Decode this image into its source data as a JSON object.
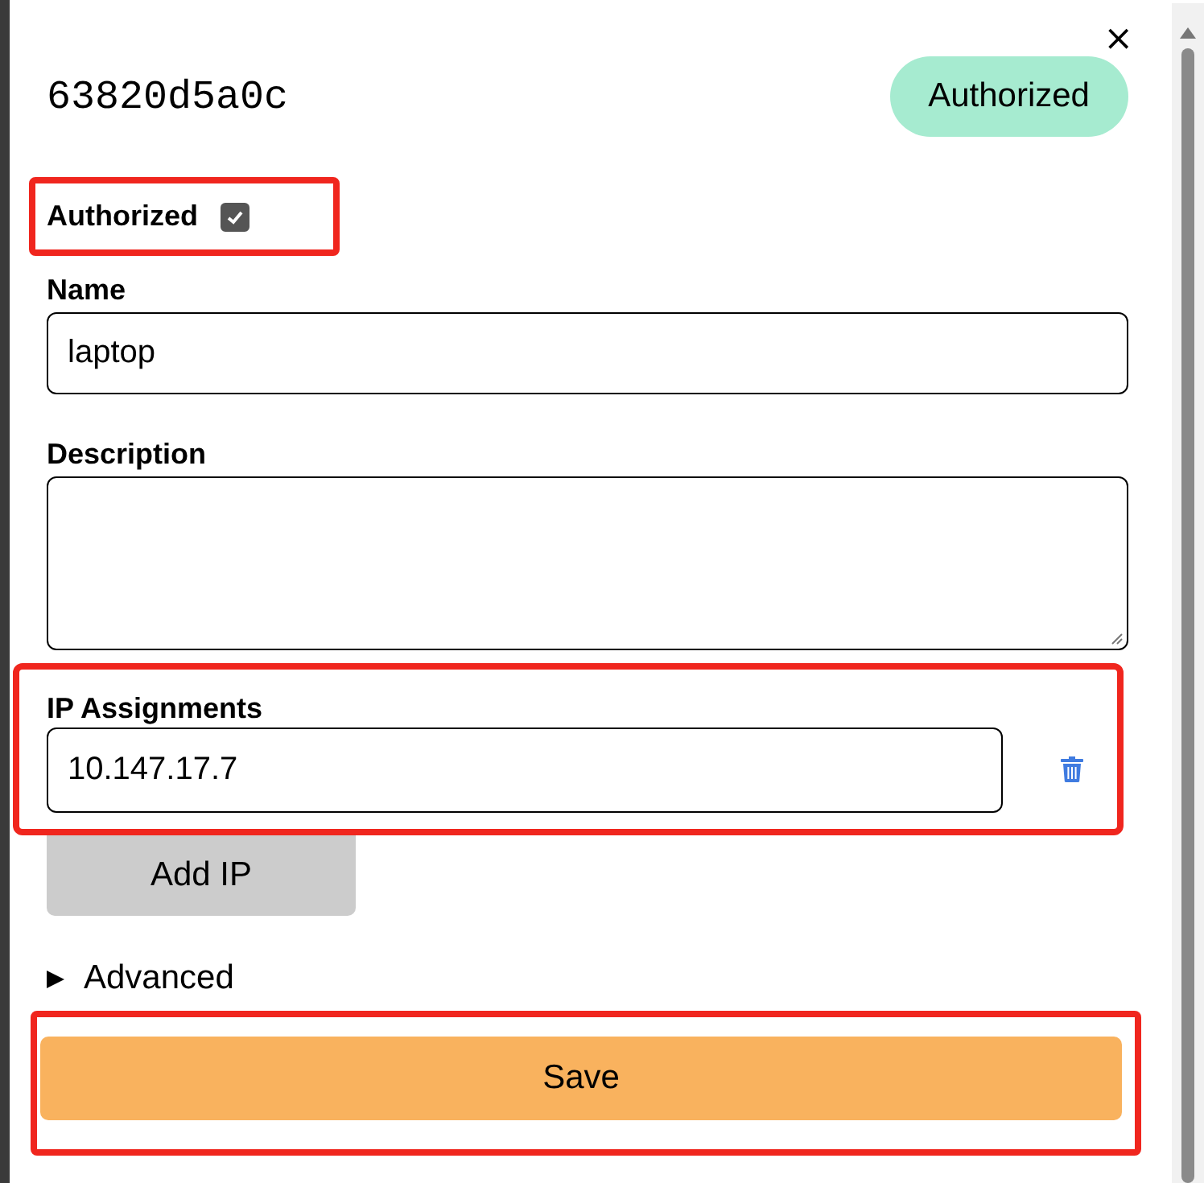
{
  "dialog": {
    "close": "×",
    "title": "63820d5a0c",
    "status_badge": "Authorized"
  },
  "authorized": {
    "label": "Authorized",
    "checked": true,
    "highlighted": true
  },
  "name": {
    "label": "Name",
    "value": "laptop"
  },
  "description": {
    "label": "Description"
  },
  "ip_assignments": {
    "label": "IP Assignments",
    "highlighted": true,
    "items": [
      {
        "value": "10.147.17.7"
      }
    ],
    "add_button": "Add IP"
  },
  "advanced": {
    "label": "Advanced",
    "expanded": false
  },
  "save": {
    "label": "Save",
    "highlighted": true
  }
}
